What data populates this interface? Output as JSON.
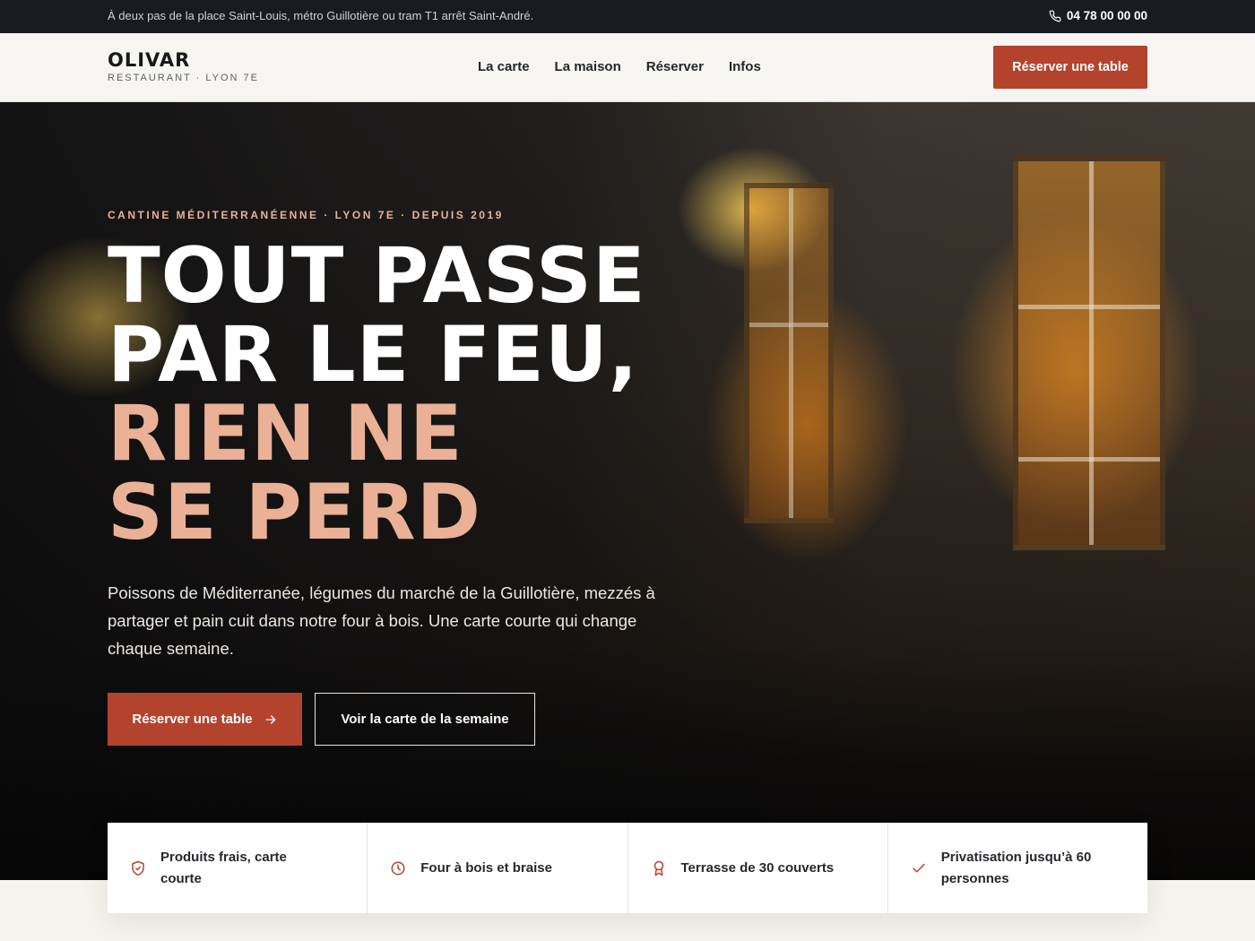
{
  "topbar": {
    "info": "À deux pas de la place Saint-Louis, métro Guillotière ou tram T1 arrêt Saint-André.",
    "phone": "04 78 00 00 00",
    "phone_icon": "phone-icon"
  },
  "header": {
    "logo_name": "OLIVAR",
    "logo_sub": "RESTAURANT · LYON 7E",
    "nav": [
      "La carte",
      "La maison",
      "Réserver",
      "Infos"
    ],
    "cta": "Réserver une table"
  },
  "hero": {
    "kicker": "CANTINE MÉDITERRANÉENNE · LYON 7E · DEPUIS 2019",
    "title_lines": [
      "TOUT PASSE",
      "PAR LE FEU,",
      "RIEN NE",
      "SE PERD"
    ],
    "description": "Poissons de Méditerranée, légumes du marché de la Guillotière, mezzés à partager et pain cuit dans notre four à bois. Une carte courte qui change chaque semaine.",
    "primary_button": "Réserver une table",
    "primary_button_icon": "arrow-right-icon",
    "secondary_button": "Voir la carte de la semaine"
  },
  "features": [
    {
      "icon": "shield-check-icon",
      "label": "Produits frais, carte courte"
    },
    {
      "icon": "clock-icon",
      "label": "Four à bois et braise"
    },
    {
      "icon": "award-icon",
      "label": "Terrasse de 30 couverts"
    },
    {
      "icon": "check-icon",
      "label": "Privatisation jusqu’à 60 personnes"
    }
  ],
  "colors": {
    "accent": "#b4432e",
    "accent_light": "#eab197",
    "topbar_bg": "#181b20",
    "header_bg": "#f7f5f1"
  }
}
